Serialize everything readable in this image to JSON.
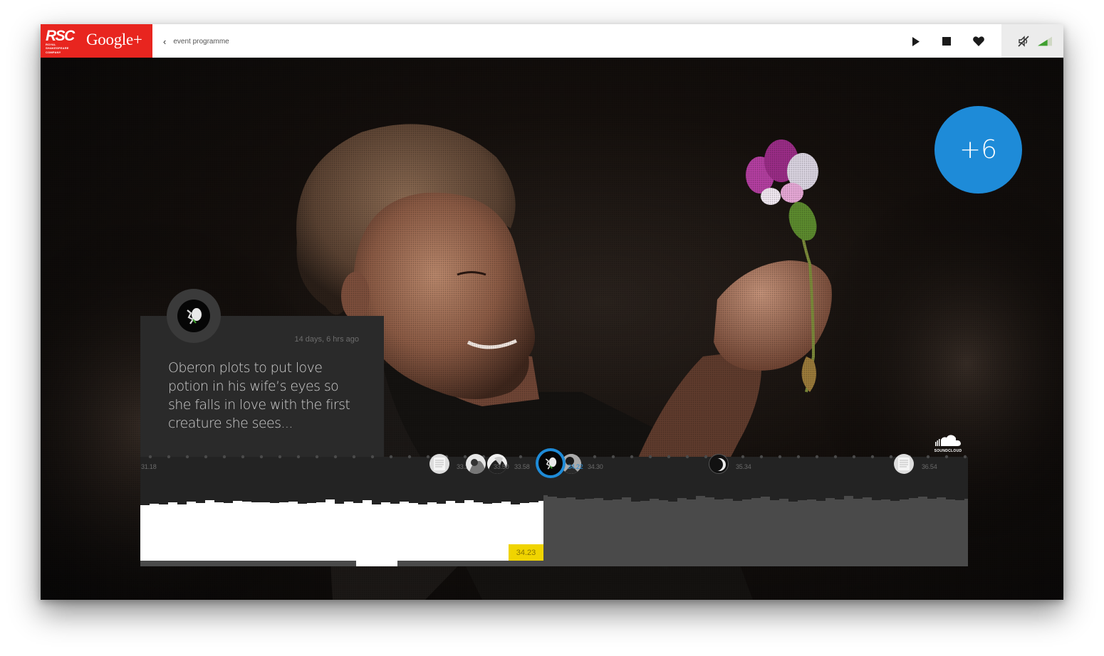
{
  "brand": {
    "logo_text": "RSC",
    "logo_subtext": [
      "ROYAL",
      "SHAKESPEARE",
      "COMPANY"
    ],
    "network": "Google+",
    "color": "#e8251f"
  },
  "nav": {
    "back_icon": "chevron-left-icon",
    "back_label": "event programme"
  },
  "controls": {
    "play_icon": "play-icon",
    "stop_icon": "stop-icon",
    "like_icon": "heart-icon",
    "mute_icon": "muted-icon",
    "volume_icon": "volume-level-icon"
  },
  "plus_count": "+6",
  "post": {
    "time_ago": "14 days, 6 hrs ago",
    "text": "Oberon plots to put love potion in his wife’s eyes so she falls in love with the first creature she sees..."
  },
  "timeline": {
    "start_time": "31.18",
    "current_time": "34.23",
    "markers": [
      {
        "time": "33.3",
        "icon": "page-icon"
      },
      {
        "time": "33.50",
        "icon": "photo-icon"
      },
      {
        "time": "33.58",
        "icon": "photo-icon"
      },
      {
        "time": "34.22",
        "icon": "oberon-icon",
        "active": true
      },
      {
        "time": "34.30",
        "icon": "photo-icon"
      },
      {
        "time": "35.34",
        "icon": "moon-icon"
      },
      {
        "time": "36.54",
        "icon": "page-icon"
      }
    ],
    "accent_color": "#1e8bd8",
    "now_color": "#f0d400"
  },
  "soundcloud": {
    "label": "SOUNDCLOUD",
    "icon": "soundcloud-icon"
  }
}
